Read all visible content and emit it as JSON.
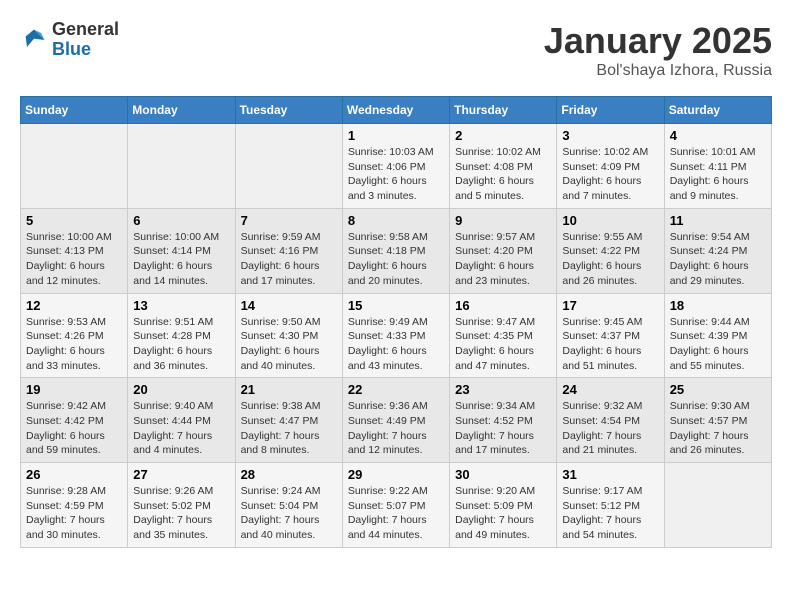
{
  "logo": {
    "general": "General",
    "blue": "Blue"
  },
  "title": "January 2025",
  "location": "Bol'shaya Izhora, Russia",
  "days_of_week": [
    "Sunday",
    "Monday",
    "Tuesday",
    "Wednesday",
    "Thursday",
    "Friday",
    "Saturday"
  ],
  "weeks": [
    [
      null,
      null,
      null,
      {
        "day": "1",
        "sunrise": "Sunrise: 10:03 AM",
        "sunset": "Sunset: 4:06 PM",
        "daylight": "Daylight: 6 hours and 3 minutes."
      },
      {
        "day": "2",
        "sunrise": "Sunrise: 10:02 AM",
        "sunset": "Sunset: 4:08 PM",
        "daylight": "Daylight: 6 hours and 5 minutes."
      },
      {
        "day": "3",
        "sunrise": "Sunrise: 10:02 AM",
        "sunset": "Sunset: 4:09 PM",
        "daylight": "Daylight: 6 hours and 7 minutes."
      },
      {
        "day": "4",
        "sunrise": "Sunrise: 10:01 AM",
        "sunset": "Sunset: 4:11 PM",
        "daylight": "Daylight: 6 hours and 9 minutes."
      }
    ],
    [
      {
        "day": "5",
        "sunrise": "Sunrise: 10:00 AM",
        "sunset": "Sunset: 4:13 PM",
        "daylight": "Daylight: 6 hours and 12 minutes."
      },
      {
        "day": "6",
        "sunrise": "Sunrise: 10:00 AM",
        "sunset": "Sunset: 4:14 PM",
        "daylight": "Daylight: 6 hours and 14 minutes."
      },
      {
        "day": "7",
        "sunrise": "Sunrise: 9:59 AM",
        "sunset": "Sunset: 4:16 PM",
        "daylight": "Daylight: 6 hours and 17 minutes."
      },
      {
        "day": "8",
        "sunrise": "Sunrise: 9:58 AM",
        "sunset": "Sunset: 4:18 PM",
        "daylight": "Daylight: 6 hours and 20 minutes."
      },
      {
        "day": "9",
        "sunrise": "Sunrise: 9:57 AM",
        "sunset": "Sunset: 4:20 PM",
        "daylight": "Daylight: 6 hours and 23 minutes."
      },
      {
        "day": "10",
        "sunrise": "Sunrise: 9:55 AM",
        "sunset": "Sunset: 4:22 PM",
        "daylight": "Daylight: 6 hours and 26 minutes."
      },
      {
        "day": "11",
        "sunrise": "Sunrise: 9:54 AM",
        "sunset": "Sunset: 4:24 PM",
        "daylight": "Daylight: 6 hours and 29 minutes."
      }
    ],
    [
      {
        "day": "12",
        "sunrise": "Sunrise: 9:53 AM",
        "sunset": "Sunset: 4:26 PM",
        "daylight": "Daylight: 6 hours and 33 minutes."
      },
      {
        "day": "13",
        "sunrise": "Sunrise: 9:51 AM",
        "sunset": "Sunset: 4:28 PM",
        "daylight": "Daylight: 6 hours and 36 minutes."
      },
      {
        "day": "14",
        "sunrise": "Sunrise: 9:50 AM",
        "sunset": "Sunset: 4:30 PM",
        "daylight": "Daylight: 6 hours and 40 minutes."
      },
      {
        "day": "15",
        "sunrise": "Sunrise: 9:49 AM",
        "sunset": "Sunset: 4:33 PM",
        "daylight": "Daylight: 6 hours and 43 minutes."
      },
      {
        "day": "16",
        "sunrise": "Sunrise: 9:47 AM",
        "sunset": "Sunset: 4:35 PM",
        "daylight": "Daylight: 6 hours and 47 minutes."
      },
      {
        "day": "17",
        "sunrise": "Sunrise: 9:45 AM",
        "sunset": "Sunset: 4:37 PM",
        "daylight": "Daylight: 6 hours and 51 minutes."
      },
      {
        "day": "18",
        "sunrise": "Sunrise: 9:44 AM",
        "sunset": "Sunset: 4:39 PM",
        "daylight": "Daylight: 6 hours and 55 minutes."
      }
    ],
    [
      {
        "day": "19",
        "sunrise": "Sunrise: 9:42 AM",
        "sunset": "Sunset: 4:42 PM",
        "daylight": "Daylight: 6 hours and 59 minutes."
      },
      {
        "day": "20",
        "sunrise": "Sunrise: 9:40 AM",
        "sunset": "Sunset: 4:44 PM",
        "daylight": "Daylight: 7 hours and 4 minutes."
      },
      {
        "day": "21",
        "sunrise": "Sunrise: 9:38 AM",
        "sunset": "Sunset: 4:47 PM",
        "daylight": "Daylight: 7 hours and 8 minutes."
      },
      {
        "day": "22",
        "sunrise": "Sunrise: 9:36 AM",
        "sunset": "Sunset: 4:49 PM",
        "daylight": "Daylight: 7 hours and 12 minutes."
      },
      {
        "day": "23",
        "sunrise": "Sunrise: 9:34 AM",
        "sunset": "Sunset: 4:52 PM",
        "daylight": "Daylight: 7 hours and 17 minutes."
      },
      {
        "day": "24",
        "sunrise": "Sunrise: 9:32 AM",
        "sunset": "Sunset: 4:54 PM",
        "daylight": "Daylight: 7 hours and 21 minutes."
      },
      {
        "day": "25",
        "sunrise": "Sunrise: 9:30 AM",
        "sunset": "Sunset: 4:57 PM",
        "daylight": "Daylight: 7 hours and 26 minutes."
      }
    ],
    [
      {
        "day": "26",
        "sunrise": "Sunrise: 9:28 AM",
        "sunset": "Sunset: 4:59 PM",
        "daylight": "Daylight: 7 hours and 30 minutes."
      },
      {
        "day": "27",
        "sunrise": "Sunrise: 9:26 AM",
        "sunset": "Sunset: 5:02 PM",
        "daylight": "Daylight: 7 hours and 35 minutes."
      },
      {
        "day": "28",
        "sunrise": "Sunrise: 9:24 AM",
        "sunset": "Sunset: 5:04 PM",
        "daylight": "Daylight: 7 hours and 40 minutes."
      },
      {
        "day": "29",
        "sunrise": "Sunrise: 9:22 AM",
        "sunset": "Sunset: 5:07 PM",
        "daylight": "Daylight: 7 hours and 44 minutes."
      },
      {
        "day": "30",
        "sunrise": "Sunrise: 9:20 AM",
        "sunset": "Sunset: 5:09 PM",
        "daylight": "Daylight: 7 hours and 49 minutes."
      },
      {
        "day": "31",
        "sunrise": "Sunrise: 9:17 AM",
        "sunset": "Sunset: 5:12 PM",
        "daylight": "Daylight: 7 hours and 54 minutes."
      },
      null
    ]
  ]
}
